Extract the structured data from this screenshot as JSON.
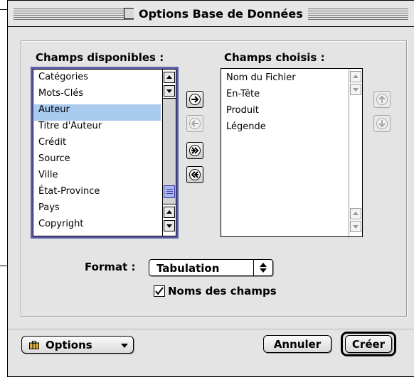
{
  "dialog": {
    "title": "Options Base de Données"
  },
  "available": {
    "heading": "Champs disponibles :",
    "items": [
      "Catégories",
      "Mots-Clés",
      "Auteur",
      "Titre d'Auteur",
      "Crédit",
      "Source",
      "Ville",
      "État-Province",
      "Pays",
      "Copyright"
    ],
    "selected": "Auteur"
  },
  "chosen": {
    "heading": "Champs choisis :",
    "items": [
      "Nom du Fichier",
      "En-Tête",
      "Produit",
      "Légende"
    ]
  },
  "format": {
    "label": "Format :",
    "value": "Tabulation"
  },
  "field_names_checkbox": {
    "label": "Noms des champs",
    "checked": true
  },
  "buttons": {
    "options": "Options",
    "cancel": "Annuler",
    "create": "Créer"
  },
  "colors": {
    "selection": "#a9cbee",
    "focus_ring": "#5a5fa8",
    "dialog_bg": "#e4e4e4"
  }
}
